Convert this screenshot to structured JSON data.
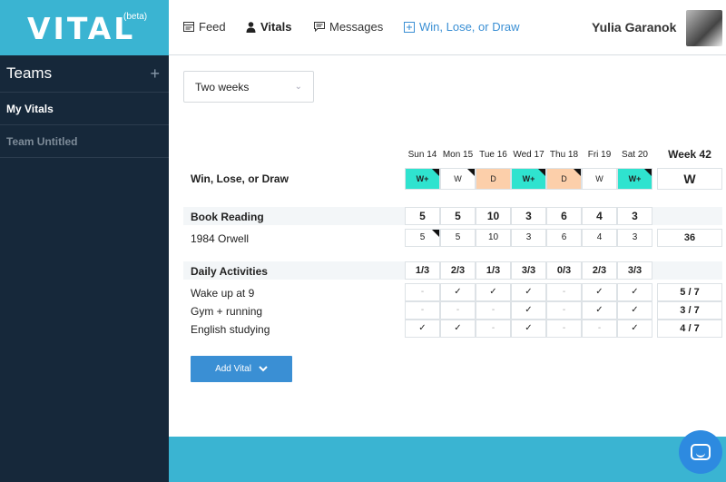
{
  "logo": {
    "text": "VITAL",
    "beta": "(beta)"
  },
  "sidebar": {
    "teams_label": "Teams",
    "add_glyph": "+",
    "items": [
      {
        "label": "My Vitals",
        "active": true
      },
      {
        "label": "Team Untitled",
        "active": false
      }
    ]
  },
  "nav": {
    "items": [
      {
        "label": "Feed",
        "icon": "feed-icon"
      },
      {
        "label": "Vitals",
        "icon": "person-icon"
      },
      {
        "label": "Messages",
        "icon": "message-icon"
      },
      {
        "label": "Win, Lose, or Draw",
        "icon": "plus-square-icon"
      }
    ],
    "user_name": "Yulia Garanok"
  },
  "period": {
    "value": "Two weeks"
  },
  "grid": {
    "days": [
      "Sun 14",
      "Mon 15",
      "Tue 16",
      "Wed 17",
      "Thu 18",
      "Fri 19",
      "Sat 20"
    ],
    "week_label": "Week 42",
    "wld": {
      "label": "Win, Lose, or Draw",
      "values": [
        "W+",
        "W",
        "D",
        "W+",
        "D",
        "W",
        "W+"
      ],
      "week": "W"
    },
    "book_reading": {
      "label": "Book Reading",
      "totals": [
        "5",
        "5",
        "10",
        "3",
        "6",
        "4",
        "3"
      ]
    },
    "orwell": {
      "label": "1984 Orwell",
      "values": [
        "5",
        "5",
        "10",
        "3",
        "6",
        "4",
        "3"
      ],
      "week": "36"
    },
    "daily": {
      "label": "Daily Activities",
      "totals": [
        "1/3",
        "2/3",
        "1/3",
        "3/3",
        "0/3",
        "2/3",
        "3/3"
      ]
    },
    "activities": [
      {
        "label": "Wake up at 9",
        "values": [
          "-",
          "✓",
          "✓",
          "✓",
          "-",
          "✓",
          "✓"
        ],
        "week": "5 / 7"
      },
      {
        "label": "Gym + running",
        "values": [
          "-",
          "-",
          "-",
          "✓",
          "-",
          "✓",
          "✓"
        ],
        "week": "3 / 7"
      },
      {
        "label": "English studying",
        "values": [
          "✓",
          "✓",
          "-",
          "✓",
          "-",
          "-",
          "✓"
        ],
        "week": "4 / 7"
      }
    ]
  },
  "add_vital": {
    "label": "Add Vital"
  },
  "colors": {
    "brand": "#3ab4d2",
    "sidebar": "#16283a",
    "accent": "#3a8fd4",
    "win_plus": "#2fe3cf",
    "draw": "#fccfaa"
  }
}
